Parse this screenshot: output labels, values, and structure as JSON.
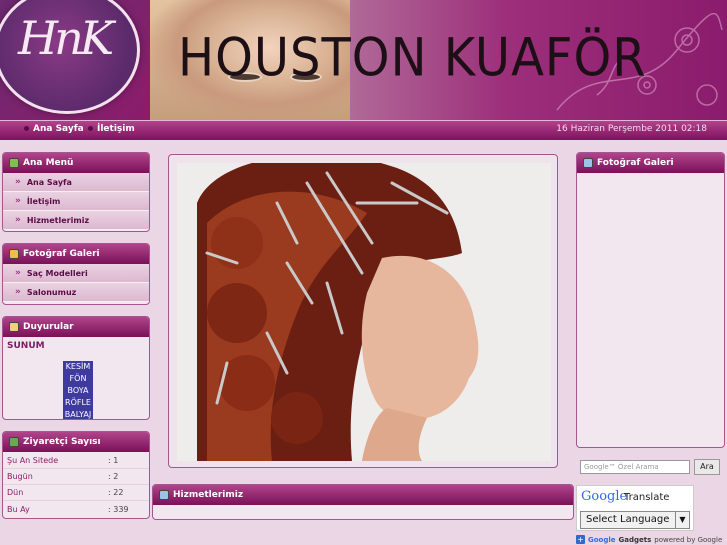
{
  "header": {
    "logo_text": "HnK",
    "site_title": "HOUSTON KUAFÖR"
  },
  "navbar": {
    "items": [
      {
        "label": "Ana Sayfa"
      },
      {
        "label": "İletişim"
      }
    ],
    "date": "16 Haziran Perşembe 2011 02:18"
  },
  "left": {
    "main_menu": {
      "title": "Ana Menü",
      "items": [
        {
          "label": "Ana Sayfa"
        },
        {
          "label": "İletişim"
        },
        {
          "label": "Hizmetlerimiz"
        }
      ]
    },
    "gallery_menu": {
      "title": "Fotoğraf Galeri",
      "items": [
        {
          "label": "Saç Modelleri"
        },
        {
          "label": "Salonumuz"
        }
      ]
    },
    "announcements": {
      "title": "Duyurular",
      "heading": "SUNUM",
      "ticker": [
        "KESİM",
        "FÖN",
        "BOYA",
        "RÖFLE",
        "BALYAJ"
      ]
    },
    "visitors": {
      "title": "Ziyaretçi Sayısı",
      "rows": [
        {
          "label": "Şu An Sitede",
          "value": ": 1"
        },
        {
          "label": "Bugün",
          "value": ": 2"
        },
        {
          "label": "Dün",
          "value": ": 22"
        },
        {
          "label": "Bu Ay",
          "value": ": 339"
        }
      ]
    }
  },
  "center": {
    "services_title": "Hizmetlerimiz"
  },
  "right": {
    "gallery_title": "Fotoğraf Galeri",
    "search": {
      "placeholder": "Google™ Özel Arama",
      "button": "Ara"
    },
    "translate": {
      "brand": "Google",
      "label": "Translate",
      "select": "Select Language"
    },
    "gadgets": {
      "brand": "Google",
      "gadgets": "Gadgets",
      "powered": "powered by Google"
    }
  },
  "colors": {
    "accent": "#8b1c6d",
    "background": "#ead6e4",
    "ticker": "#3f3a9e"
  }
}
